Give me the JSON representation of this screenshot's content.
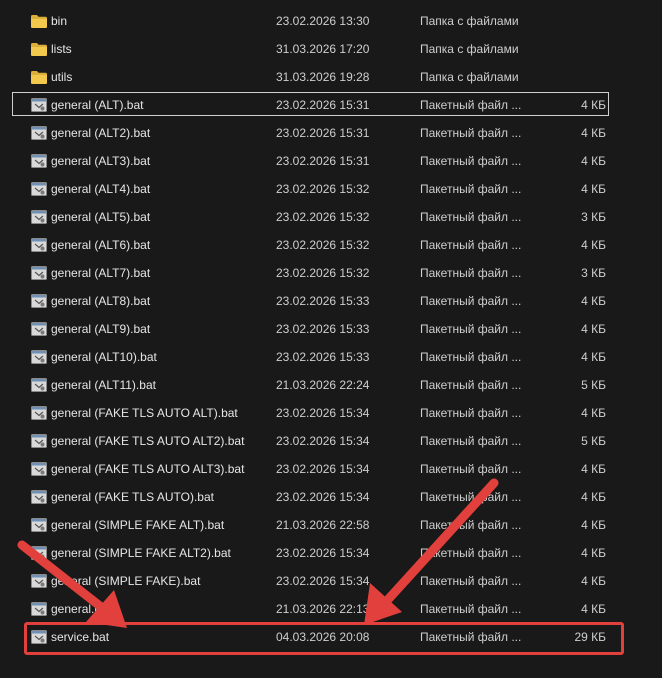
{
  "files": [
    {
      "name": "bin",
      "date": "23.02.2026 13:30",
      "type": "Папка с файлами",
      "size": "",
      "icon": "folder-icon"
    },
    {
      "name": "lists",
      "date": "31.03.2026 17:20",
      "type": "Папка с файлами",
      "size": "",
      "icon": "folder-icon"
    },
    {
      "name": "utils",
      "date": "31.03.2026 19:28",
      "type": "Папка с файлами",
      "size": "",
      "icon": "folder-icon"
    },
    {
      "name": "general (ALT).bat",
      "date": "23.02.2026 15:31",
      "type": "Пакетный файл ...",
      "size": "4 КБ",
      "icon": "batch-file-icon"
    },
    {
      "name": "general (ALT2).bat",
      "date": "23.02.2026 15:31",
      "type": "Пакетный файл ...",
      "size": "4 КБ",
      "icon": "batch-file-icon"
    },
    {
      "name": "general (ALT3).bat",
      "date": "23.02.2026 15:31",
      "type": "Пакетный файл ...",
      "size": "4 КБ",
      "icon": "batch-file-icon"
    },
    {
      "name": "general (ALT4).bat",
      "date": "23.02.2026 15:32",
      "type": "Пакетный файл ...",
      "size": "4 КБ",
      "icon": "batch-file-icon"
    },
    {
      "name": "general (ALT5).bat",
      "date": "23.02.2026 15:32",
      "type": "Пакетный файл ...",
      "size": "3 КБ",
      "icon": "batch-file-icon"
    },
    {
      "name": "general (ALT6).bat",
      "date": "23.02.2026 15:32",
      "type": "Пакетный файл ...",
      "size": "4 КБ",
      "icon": "batch-file-icon"
    },
    {
      "name": "general (ALT7).bat",
      "date": "23.02.2026 15:32",
      "type": "Пакетный файл ...",
      "size": "3 КБ",
      "icon": "batch-file-icon"
    },
    {
      "name": "general (ALT8).bat",
      "date": "23.02.2026 15:33",
      "type": "Пакетный файл ...",
      "size": "4 КБ",
      "icon": "batch-file-icon"
    },
    {
      "name": "general (ALT9).bat",
      "date": "23.02.2026 15:33",
      "type": "Пакетный файл ...",
      "size": "4 КБ",
      "icon": "batch-file-icon"
    },
    {
      "name": "general (ALT10).bat",
      "date": "23.02.2026 15:33",
      "type": "Пакетный файл ...",
      "size": "4 КБ",
      "icon": "batch-file-icon"
    },
    {
      "name": "general (ALT11).bat",
      "date": "21.03.2026 22:24",
      "type": "Пакетный файл ...",
      "size": "5 КБ",
      "icon": "batch-file-icon"
    },
    {
      "name": "general (FAKE TLS AUTO ALT).bat",
      "date": "23.02.2026 15:34",
      "type": "Пакетный файл ...",
      "size": "4 КБ",
      "icon": "batch-file-icon"
    },
    {
      "name": "general (FAKE TLS AUTO ALT2).bat",
      "date": "23.02.2026 15:34",
      "type": "Пакетный файл ...",
      "size": "5 КБ",
      "icon": "batch-file-icon"
    },
    {
      "name": "general (FAKE TLS AUTO ALT3).bat",
      "date": "23.02.2026 15:34",
      "type": "Пакетный файл ...",
      "size": "4 КБ",
      "icon": "batch-file-icon"
    },
    {
      "name": "general (FAKE TLS AUTO).bat",
      "date": "23.02.2026 15:34",
      "type": "Пакетный файл ...",
      "size": "4 КБ",
      "icon": "batch-file-icon"
    },
    {
      "name": "general (SIMPLE FAKE ALT).bat",
      "date": "21.03.2026 22:58",
      "type": "Пакетный файл ...",
      "size": "4 КБ",
      "icon": "batch-file-icon"
    },
    {
      "name": "general (SIMPLE FAKE ALT2).bat",
      "date": "23.02.2026 15:34",
      "type": "Пакетный файл ...",
      "size": "4 КБ",
      "icon": "batch-file-icon"
    },
    {
      "name": "general (SIMPLE FAKE).bat",
      "date": "23.02.2026 15:34",
      "type": "Пакетный файл ...",
      "size": "4 КБ",
      "icon": "batch-file-icon"
    },
    {
      "name": "general.bat",
      "date": "21.03.2026 22:13",
      "type": "Пакетный файл ...",
      "size": "4 КБ",
      "icon": "batch-file-icon"
    },
    {
      "name": "service.bat",
      "date": "04.03.2026 20:08",
      "type": "Пакетный файл ...",
      "size": "29 КБ",
      "icon": "batch-file-icon"
    }
  ],
  "focused_file": "general (ALT).bat",
  "highlighted_file": "service.bat",
  "colors": {
    "background": "#191919",
    "text": "#e6e6e6",
    "folder": "#f2c94c",
    "annotation": "#e2403c",
    "focus_border": "#cfcfcf"
  }
}
